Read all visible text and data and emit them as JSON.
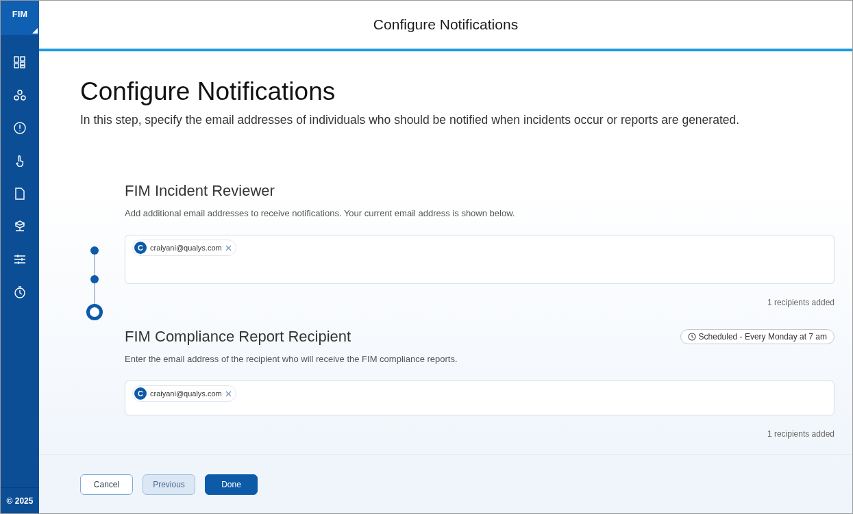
{
  "sidebar": {
    "logo": "FIM",
    "footer": "© 2025"
  },
  "header": {
    "title": "Configure Notifications"
  },
  "page": {
    "title": "Configure Notifications",
    "description": "In this step, specify the email addresses of individuals who should be notified when incidents occur or reports are generated."
  },
  "stepper": [
    {
      "current": false
    },
    {
      "current": false
    },
    {
      "current": true
    }
  ],
  "sections": [
    {
      "title": "FIM Incident Reviewer",
      "description": "Add additional email addresses to receive notifications. Your current email address is shown below.",
      "recipients": [
        {
          "initial": "C",
          "email": "craiyani@qualys.com"
        }
      ],
      "count": "1 recipients added",
      "tall": true
    },
    {
      "title": "FIM Compliance Report Recipient",
      "schedule": "Scheduled - Every Monday at 7 am",
      "description": "Enter the email address of the recipient who will receive the FIM compliance reports.",
      "recipients": [
        {
          "initial": "C",
          "email": "craiyani@qualys.com"
        }
      ],
      "count": "1 recipients added",
      "tall": false
    }
  ],
  "buttons": [
    {
      "label": "Cancel",
      "kind": "outline"
    },
    {
      "label": "Previous",
      "kind": "secondary"
    },
    {
      "label": "Done",
      "kind": "primary"
    }
  ]
}
